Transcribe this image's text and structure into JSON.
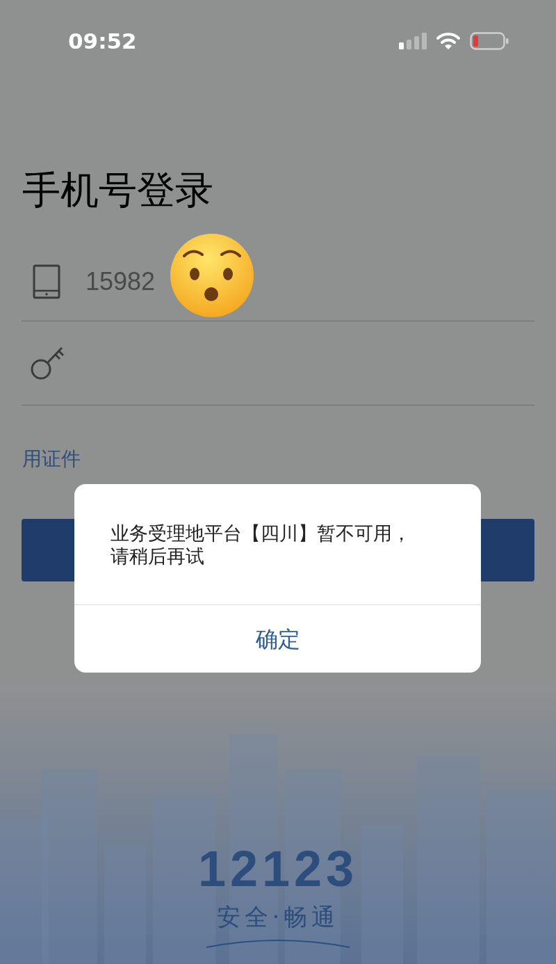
{
  "status_bar": {
    "time": "09:52"
  },
  "title": "手机号登录",
  "phone_field": {
    "value": "15982"
  },
  "alt_login_link": "用证件",
  "dialog": {
    "message": "业务受理地平台【四川】暂不可用，请稍后再试",
    "button": "确定"
  },
  "logo": {
    "number": "12123",
    "slogan": "安全·畅通"
  }
}
